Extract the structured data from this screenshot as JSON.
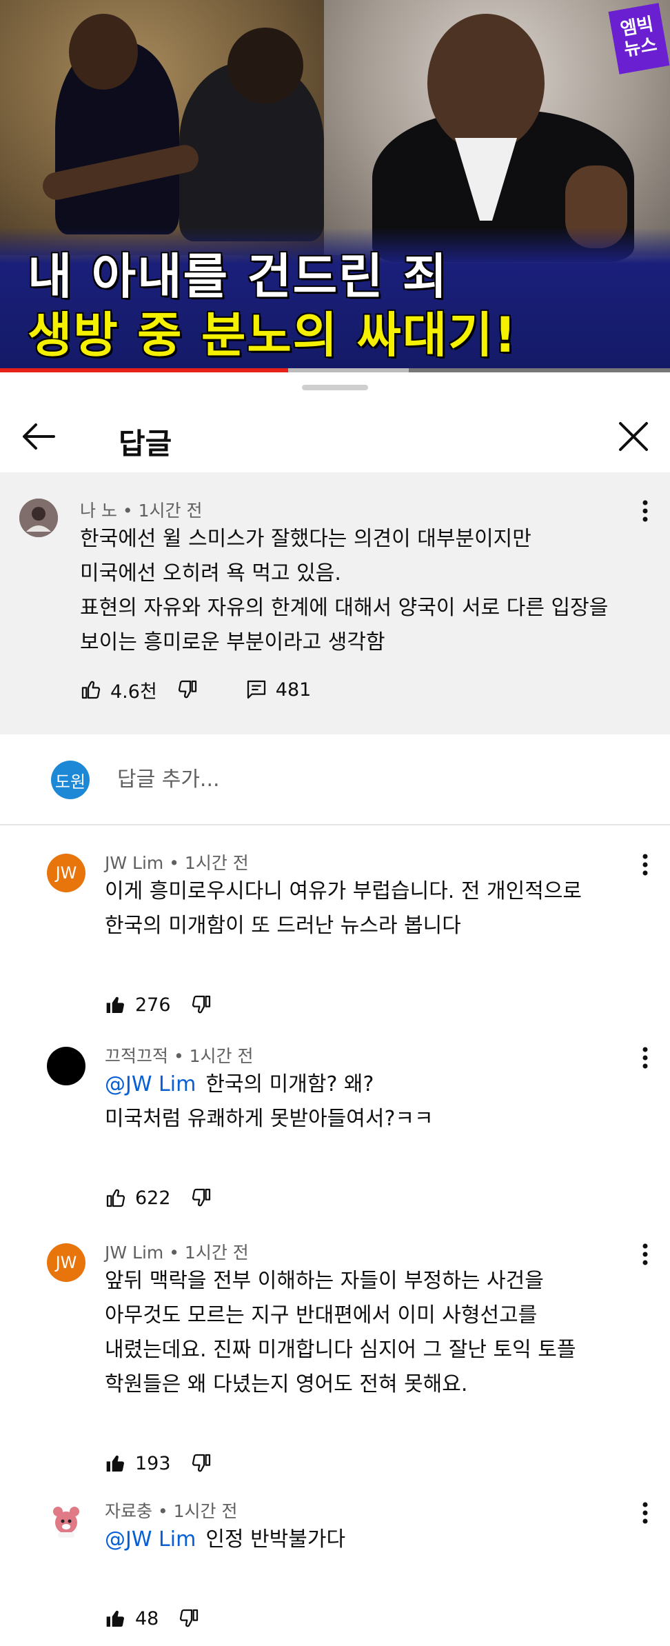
{
  "video": {
    "title_line1": "내 아내를 건드린 죄",
    "title_line2": "생방 중 분노의 싸대기!",
    "logo_text": "엠빅\n뉴스",
    "progress_played_fraction": 0.43,
    "progress_buffered_fraction": 0.61,
    "colors": {
      "played": "#e62117",
      "title_line2": "#f4f000",
      "logo": "#6a1fd1"
    }
  },
  "sheet": {
    "title": "답글",
    "back_icon": "arrow-left-icon",
    "close_icon": "close-icon"
  },
  "parent_comment": {
    "author": "나 노",
    "time": "1시간 전",
    "lines": [
      "한국에선 윌 스미스가 잘했다는 의견이 대부분이지만",
      "미국에선 오히려 욕 먹고 있음.",
      "표현의 자유와 자유의 한계에 대해서 양국이 서로 다른 입장을",
      "보이는 흥미로운 부분이라고 생각함"
    ],
    "likes": "4.6천",
    "replies": "481"
  },
  "add_reply": {
    "avatar_text": "도원",
    "placeholder": "답글 추가..."
  },
  "replies": [
    {
      "author": "JW Lim",
      "time": "1시간 전",
      "avatar_text": "JW",
      "avatar_color": "#e8740c",
      "mention": "",
      "lines": [
        "이게 흥미로우시다니 여유가 부럽습니다. 전 개인적으로",
        "한국의 미개함이 또 드러난 뉴스라 봅니다"
      ],
      "likes": "276",
      "liked": true
    },
    {
      "author": "끄적끄적",
      "time": "1시간 전",
      "avatar_text": "",
      "avatar_color": "#000000",
      "mention": "@JW Lim",
      "lines": [
        "한국의 미개함? 왜?",
        "미국처럼 유쾌하게 못받아들여서?ㅋㅋ"
      ],
      "likes": "622",
      "liked": false
    },
    {
      "author": "JW Lim",
      "time": "1시간 전",
      "avatar_text": "JW",
      "avatar_color": "#e8740c",
      "mention": "",
      "lines": [
        "앞뒤 맥락을 전부 이해하는 자들이 부정하는 사건을",
        "아무것도 모르는 지구 반대편에서 이미 사형선고를",
        "내렸는데요. 진짜 미개합니다 심지어 그 잘난 토익 토플",
        "학원들은 왜 다녔는지 영어도 전혀 못해요."
      ],
      "likes": "193",
      "liked": true
    },
    {
      "author": "자료충",
      "time": "1시간 전",
      "avatar_text": "",
      "avatar_color": "#f3c6c9",
      "mention": "@JW Lim",
      "lines": [
        "인정 반박불가다"
      ],
      "likes": "48",
      "liked": true
    }
  ]
}
